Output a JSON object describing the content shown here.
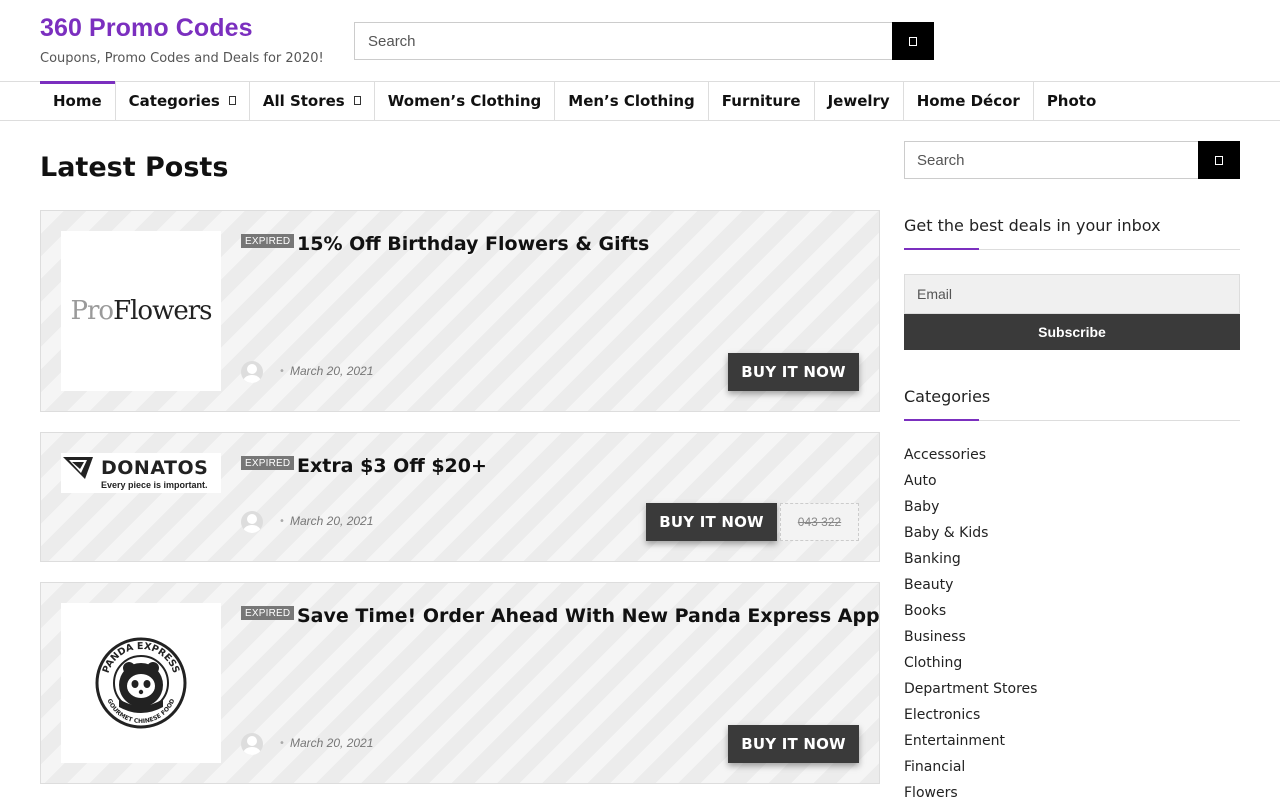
{
  "site": {
    "title": "360 Promo Codes",
    "tagline": "Coupons, Promo Codes and Deals for 2020!",
    "search_placeholder": "Search",
    "accent_color": "#7b2fbf"
  },
  "nav": {
    "items": [
      {
        "label": "Home",
        "active": true
      },
      {
        "label": "Categories",
        "has_dropdown": true
      },
      {
        "label": "All Stores",
        "has_dropdown": true
      },
      {
        "label": "Women’s Clothing"
      },
      {
        "label": "Men’s Clothing"
      },
      {
        "label": "Furniture"
      },
      {
        "label": "Jewelry"
      },
      {
        "label": "Home Décor"
      },
      {
        "label": "Photo"
      }
    ]
  },
  "main": {
    "heading": "Latest Posts",
    "posts": [
      {
        "store": "ProFlowers",
        "logo_text_pro": "Pro",
        "logo_text_rest": "Flowers",
        "badge": "EXPIRED",
        "title": "15% Off Birthday Flowers & Gifts",
        "date": "March 20, 2021",
        "button": "BUY IT NOW"
      },
      {
        "store": "Donatos",
        "logo_name": "DONATOS",
        "logo_tagline": "Every piece is important.",
        "badge": "EXPIRED",
        "title": "Extra $3 Off $20+",
        "date": "March 20, 2021",
        "button": "BUY IT NOW",
        "code": "043 322"
      },
      {
        "store": "Panda Express",
        "logo_ring_top": "PANDA EXPRESS",
        "logo_ring_bottom": "GOURMET CHINESE FOOD",
        "badge": "EXPIRED",
        "title": "Save Time! Order Ahead With New Panda Express App",
        "date": "March 20, 2021",
        "button": "BUY IT NOW"
      }
    ]
  },
  "sidebar": {
    "search_placeholder": "Search",
    "newsletter": {
      "title": "Get the best deals in your inbox",
      "email_placeholder": "Email",
      "button": "Subscribe"
    },
    "categories": {
      "title": "Categories",
      "items": [
        "Accessories",
        "Auto",
        "Baby",
        "Baby & Kids",
        "Banking",
        "Beauty",
        "Books",
        "Business",
        "Clothing",
        "Department Stores",
        "Electronics",
        "Entertainment",
        "Financial",
        "Flowers"
      ]
    }
  },
  "icons": {
    "search": "search-icon",
    "dropdown": "chevron-down-icon",
    "avatar": "user-avatar-icon"
  }
}
